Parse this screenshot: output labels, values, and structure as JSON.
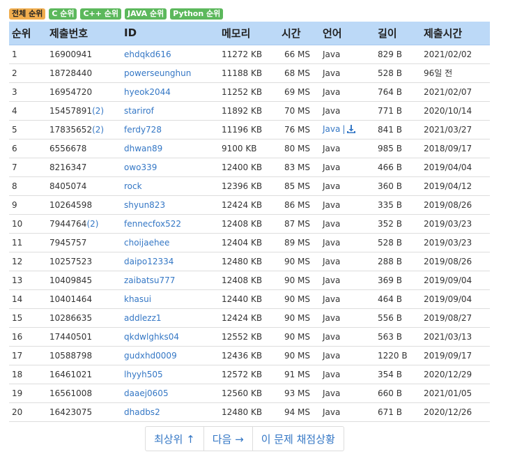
{
  "tabs": [
    {
      "label": "전체 순위",
      "active": true
    },
    {
      "label": "C 순위",
      "active": false
    },
    {
      "label": "C++ 순위",
      "active": false
    },
    {
      "label": "JAVA 순위",
      "active": false
    },
    {
      "label": "Python 순위",
      "active": false
    }
  ],
  "table": {
    "headers": [
      "순위",
      "제출번호",
      "ID",
      "메모리",
      "시간",
      "언어",
      "길이",
      "제출시간"
    ],
    "rows": [
      {
        "rank": "1",
        "submission": "16900941",
        "extra": "",
        "id": "ehdqkd616",
        "memory": "11272 KB",
        "time": "66 MS",
        "lang": "Java",
        "download": false,
        "length": "829 B",
        "submitted": "2021/02/02"
      },
      {
        "rank": "2",
        "submission": "18728440",
        "extra": "",
        "id": "powerseunghun",
        "memory": "11188 KB",
        "time": "68 MS",
        "lang": "Java",
        "download": false,
        "length": "528 B",
        "submitted": "96일 전"
      },
      {
        "rank": "3",
        "submission": "16954720",
        "extra": "",
        "id": "hyeok2044",
        "memory": "11252 KB",
        "time": "69 MS",
        "lang": "Java",
        "download": false,
        "length": "764 B",
        "submitted": "2021/02/07"
      },
      {
        "rank": "4",
        "submission": "15457891",
        "extra": "(2)",
        "id": "starirof",
        "memory": "11892 KB",
        "time": "70 MS",
        "lang": "Java",
        "download": false,
        "length": "771 B",
        "submitted": "2020/10/14"
      },
      {
        "rank": "5",
        "submission": "17835652",
        "extra": "(2)",
        "id": "ferdy728",
        "memory": "11196 KB",
        "time": "76 MS",
        "lang": "Java",
        "download": true,
        "length": "841 B",
        "submitted": "2021/03/27"
      },
      {
        "rank": "6",
        "submission": "6556678",
        "extra": "",
        "id": "dhwan89",
        "memory": "9100 KB",
        "time": "80 MS",
        "lang": "Java",
        "download": false,
        "length": "985 B",
        "submitted": "2018/09/17"
      },
      {
        "rank": "7",
        "submission": "8216347",
        "extra": "",
        "id": "owo339",
        "memory": "12400 KB",
        "time": "83 MS",
        "lang": "Java",
        "download": false,
        "length": "466 B",
        "submitted": "2019/04/04"
      },
      {
        "rank": "8",
        "submission": "8405074",
        "extra": "",
        "id": "rock",
        "memory": "12396 KB",
        "time": "85 MS",
        "lang": "Java",
        "download": false,
        "length": "360 B",
        "submitted": "2019/04/12"
      },
      {
        "rank": "9",
        "submission": "10264598",
        "extra": "",
        "id": "shyun823",
        "memory": "12424 KB",
        "time": "86 MS",
        "lang": "Java",
        "download": false,
        "length": "335 B",
        "submitted": "2019/08/26"
      },
      {
        "rank": "10",
        "submission": "7944764",
        "extra": "(2)",
        "id": "fennecfox522",
        "memory": "12408 KB",
        "time": "87 MS",
        "lang": "Java",
        "download": false,
        "length": "352 B",
        "submitted": "2019/03/23"
      },
      {
        "rank": "11",
        "submission": "7945757",
        "extra": "",
        "id": "choijaehee",
        "memory": "12404 KB",
        "time": "89 MS",
        "lang": "Java",
        "download": false,
        "length": "528 B",
        "submitted": "2019/03/23"
      },
      {
        "rank": "12",
        "submission": "10257523",
        "extra": "",
        "id": "daipo12334",
        "memory": "12480 KB",
        "time": "90 MS",
        "lang": "Java",
        "download": false,
        "length": "288 B",
        "submitted": "2019/08/26"
      },
      {
        "rank": "13",
        "submission": "10409845",
        "extra": "",
        "id": "zaibatsu777",
        "memory": "12408 KB",
        "time": "90 MS",
        "lang": "Java",
        "download": false,
        "length": "369 B",
        "submitted": "2019/09/04"
      },
      {
        "rank": "14",
        "submission": "10401464",
        "extra": "",
        "id": "khasui",
        "memory": "12440 KB",
        "time": "90 MS",
        "lang": "Java",
        "download": false,
        "length": "464 B",
        "submitted": "2019/09/04"
      },
      {
        "rank": "15",
        "submission": "10286635",
        "extra": "",
        "id": "addlezz1",
        "memory": "12424 KB",
        "time": "90 MS",
        "lang": "Java",
        "download": false,
        "length": "556 B",
        "submitted": "2019/08/27"
      },
      {
        "rank": "16",
        "submission": "17440501",
        "extra": "",
        "id": "qkdwlghks04",
        "memory": "12552 KB",
        "time": "90 MS",
        "lang": "Java",
        "download": false,
        "length": "563 B",
        "submitted": "2021/03/13"
      },
      {
        "rank": "17",
        "submission": "10588798",
        "extra": "",
        "id": "gudxhd0009",
        "memory": "12436 KB",
        "time": "90 MS",
        "lang": "Java",
        "download": false,
        "length": "1220 B",
        "submitted": "2019/09/17"
      },
      {
        "rank": "18",
        "submission": "16461021",
        "extra": "",
        "id": "lhyyh505",
        "memory": "12572 KB",
        "time": "91 MS",
        "lang": "Java",
        "download": false,
        "length": "354 B",
        "submitted": "2020/12/29"
      },
      {
        "rank": "19",
        "submission": "16561008",
        "extra": "",
        "id": "daaej0605",
        "memory": "12560 KB",
        "time": "93 MS",
        "lang": "Java",
        "download": false,
        "length": "660 B",
        "submitted": "2021/01/05"
      },
      {
        "rank": "20",
        "submission": "16423075",
        "extra": "",
        "id": "dhadbs2",
        "memory": "12480 KB",
        "time": "94 MS",
        "lang": "Java",
        "download": false,
        "length": "671 B",
        "submitted": "2020/12/26"
      }
    ]
  },
  "pager": {
    "top_label": "최상위 ↑",
    "next_label": "다음 →",
    "status_label": "이 문제 채점상황"
  },
  "colors": {
    "header_bg": "#bcd9f7",
    "link": "#3477c5",
    "tab_active": "#f0ad4e",
    "tab_green": "#5cb85c"
  },
  "icons": {
    "download": "download-icon"
  }
}
